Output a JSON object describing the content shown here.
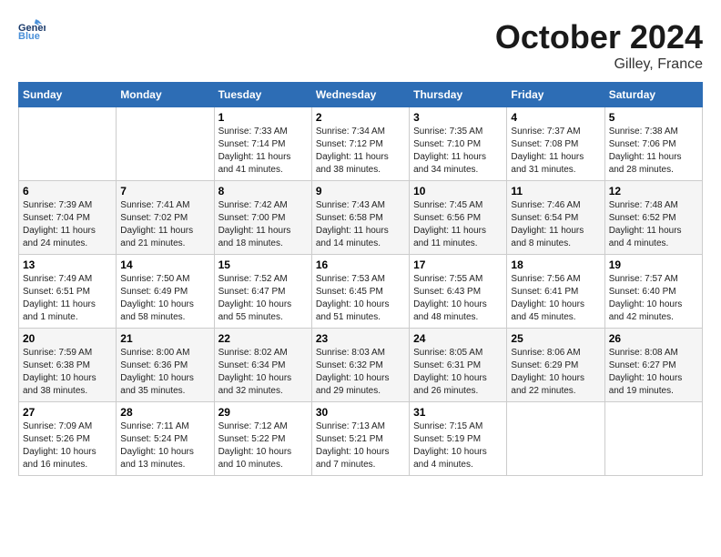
{
  "header": {
    "logo_line1": "General",
    "logo_line2": "Blue",
    "month": "October 2024",
    "location": "Gilley, France"
  },
  "weekdays": [
    "Sunday",
    "Monday",
    "Tuesday",
    "Wednesday",
    "Thursday",
    "Friday",
    "Saturday"
  ],
  "weeks": [
    [
      {
        "day": "",
        "info": ""
      },
      {
        "day": "",
        "info": ""
      },
      {
        "day": "1",
        "info": "Sunrise: 7:33 AM\nSunset: 7:14 PM\nDaylight: 11 hours and 41 minutes."
      },
      {
        "day": "2",
        "info": "Sunrise: 7:34 AM\nSunset: 7:12 PM\nDaylight: 11 hours and 38 minutes."
      },
      {
        "day": "3",
        "info": "Sunrise: 7:35 AM\nSunset: 7:10 PM\nDaylight: 11 hours and 34 minutes."
      },
      {
        "day": "4",
        "info": "Sunrise: 7:37 AM\nSunset: 7:08 PM\nDaylight: 11 hours and 31 minutes."
      },
      {
        "day": "5",
        "info": "Sunrise: 7:38 AM\nSunset: 7:06 PM\nDaylight: 11 hours and 28 minutes."
      }
    ],
    [
      {
        "day": "6",
        "info": "Sunrise: 7:39 AM\nSunset: 7:04 PM\nDaylight: 11 hours and 24 minutes."
      },
      {
        "day": "7",
        "info": "Sunrise: 7:41 AM\nSunset: 7:02 PM\nDaylight: 11 hours and 21 minutes."
      },
      {
        "day": "8",
        "info": "Sunrise: 7:42 AM\nSunset: 7:00 PM\nDaylight: 11 hours and 18 minutes."
      },
      {
        "day": "9",
        "info": "Sunrise: 7:43 AM\nSunset: 6:58 PM\nDaylight: 11 hours and 14 minutes."
      },
      {
        "day": "10",
        "info": "Sunrise: 7:45 AM\nSunset: 6:56 PM\nDaylight: 11 hours and 11 minutes."
      },
      {
        "day": "11",
        "info": "Sunrise: 7:46 AM\nSunset: 6:54 PM\nDaylight: 11 hours and 8 minutes."
      },
      {
        "day": "12",
        "info": "Sunrise: 7:48 AM\nSunset: 6:52 PM\nDaylight: 11 hours and 4 minutes."
      }
    ],
    [
      {
        "day": "13",
        "info": "Sunrise: 7:49 AM\nSunset: 6:51 PM\nDaylight: 11 hours and 1 minute."
      },
      {
        "day": "14",
        "info": "Sunrise: 7:50 AM\nSunset: 6:49 PM\nDaylight: 10 hours and 58 minutes."
      },
      {
        "day": "15",
        "info": "Sunrise: 7:52 AM\nSunset: 6:47 PM\nDaylight: 10 hours and 55 minutes."
      },
      {
        "day": "16",
        "info": "Sunrise: 7:53 AM\nSunset: 6:45 PM\nDaylight: 10 hours and 51 minutes."
      },
      {
        "day": "17",
        "info": "Sunrise: 7:55 AM\nSunset: 6:43 PM\nDaylight: 10 hours and 48 minutes."
      },
      {
        "day": "18",
        "info": "Sunrise: 7:56 AM\nSunset: 6:41 PM\nDaylight: 10 hours and 45 minutes."
      },
      {
        "day": "19",
        "info": "Sunrise: 7:57 AM\nSunset: 6:40 PM\nDaylight: 10 hours and 42 minutes."
      }
    ],
    [
      {
        "day": "20",
        "info": "Sunrise: 7:59 AM\nSunset: 6:38 PM\nDaylight: 10 hours and 38 minutes."
      },
      {
        "day": "21",
        "info": "Sunrise: 8:00 AM\nSunset: 6:36 PM\nDaylight: 10 hours and 35 minutes."
      },
      {
        "day": "22",
        "info": "Sunrise: 8:02 AM\nSunset: 6:34 PM\nDaylight: 10 hours and 32 minutes."
      },
      {
        "day": "23",
        "info": "Sunrise: 8:03 AM\nSunset: 6:32 PM\nDaylight: 10 hours and 29 minutes."
      },
      {
        "day": "24",
        "info": "Sunrise: 8:05 AM\nSunset: 6:31 PM\nDaylight: 10 hours and 26 minutes."
      },
      {
        "day": "25",
        "info": "Sunrise: 8:06 AM\nSunset: 6:29 PM\nDaylight: 10 hours and 22 minutes."
      },
      {
        "day": "26",
        "info": "Sunrise: 8:08 AM\nSunset: 6:27 PM\nDaylight: 10 hours and 19 minutes."
      }
    ],
    [
      {
        "day": "27",
        "info": "Sunrise: 7:09 AM\nSunset: 5:26 PM\nDaylight: 10 hours and 16 minutes."
      },
      {
        "day": "28",
        "info": "Sunrise: 7:11 AM\nSunset: 5:24 PM\nDaylight: 10 hours and 13 minutes."
      },
      {
        "day": "29",
        "info": "Sunrise: 7:12 AM\nSunset: 5:22 PM\nDaylight: 10 hours and 10 minutes."
      },
      {
        "day": "30",
        "info": "Sunrise: 7:13 AM\nSunset: 5:21 PM\nDaylight: 10 hours and 7 minutes."
      },
      {
        "day": "31",
        "info": "Sunrise: 7:15 AM\nSunset: 5:19 PM\nDaylight: 10 hours and 4 minutes."
      },
      {
        "day": "",
        "info": ""
      },
      {
        "day": "",
        "info": ""
      }
    ]
  ]
}
